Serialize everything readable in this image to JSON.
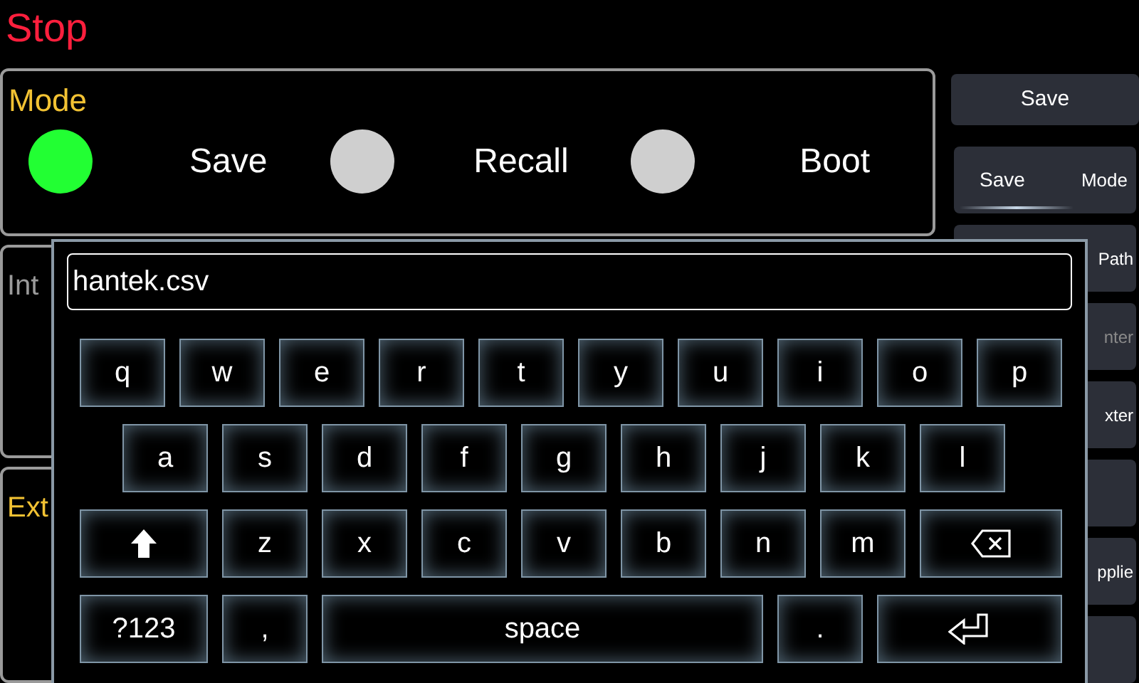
{
  "title": "Stop",
  "mode_panel": {
    "label": "Mode",
    "options": [
      {
        "label": "Save",
        "selected": true
      },
      {
        "label": "Recall",
        "selected": false
      },
      {
        "label": "Boot",
        "selected": false
      }
    ]
  },
  "panels": [
    {
      "label": "Int",
      "active": false
    },
    {
      "label": "Ext",
      "active": true
    }
  ],
  "sidebar": {
    "header_button": "Save",
    "items": [
      {
        "kind": "toggle",
        "label": "Save",
        "value": "Mode",
        "disabled": false
      },
      {
        "kind": "plain",
        "label": "Path",
        "disabled": false
      },
      {
        "kind": "plain",
        "label": "nter",
        "disabled": true
      },
      {
        "kind": "plain",
        "label": "xter",
        "disabled": false
      },
      {
        "kind": "blank"
      },
      {
        "kind": "plain",
        "label": "pplie",
        "disabled": false
      },
      {
        "kind": "blank"
      }
    ]
  },
  "keyboard": {
    "value": "hantek.csv",
    "rows": [
      {
        "keys": [
          {
            "kind": "char",
            "label": "q"
          },
          {
            "kind": "char",
            "label": "w"
          },
          {
            "kind": "char",
            "label": "e"
          },
          {
            "kind": "char",
            "label": "r"
          },
          {
            "kind": "char",
            "label": "t"
          },
          {
            "kind": "char",
            "label": "y"
          },
          {
            "kind": "char",
            "label": "u"
          },
          {
            "kind": "char",
            "label": "i"
          },
          {
            "kind": "char",
            "label": "o"
          },
          {
            "kind": "char",
            "label": "p"
          }
        ]
      },
      {
        "keys": [
          {
            "kind": "char",
            "label": "a"
          },
          {
            "kind": "char",
            "label": "s"
          },
          {
            "kind": "char",
            "label": "d"
          },
          {
            "kind": "char",
            "label": "f"
          },
          {
            "kind": "char",
            "label": "g"
          },
          {
            "kind": "char",
            "label": "h"
          },
          {
            "kind": "char",
            "label": "j"
          },
          {
            "kind": "char",
            "label": "k"
          },
          {
            "kind": "char",
            "label": "l"
          }
        ]
      },
      {
        "keys": [
          {
            "kind": "shift"
          },
          {
            "kind": "char",
            "label": "z"
          },
          {
            "kind": "char",
            "label": "x"
          },
          {
            "kind": "char",
            "label": "c"
          },
          {
            "kind": "char",
            "label": "v"
          },
          {
            "kind": "char",
            "label": "b"
          },
          {
            "kind": "char",
            "label": "n"
          },
          {
            "kind": "char",
            "label": "m"
          },
          {
            "kind": "backspace"
          }
        ]
      },
      {
        "keys": [
          {
            "kind": "wide",
            "label": "?123"
          },
          {
            "kind": "char",
            "label": ","
          },
          {
            "kind": "space",
            "label": "space"
          },
          {
            "kind": "char",
            "label": "."
          },
          {
            "kind": "enter"
          }
        ]
      }
    ]
  }
}
